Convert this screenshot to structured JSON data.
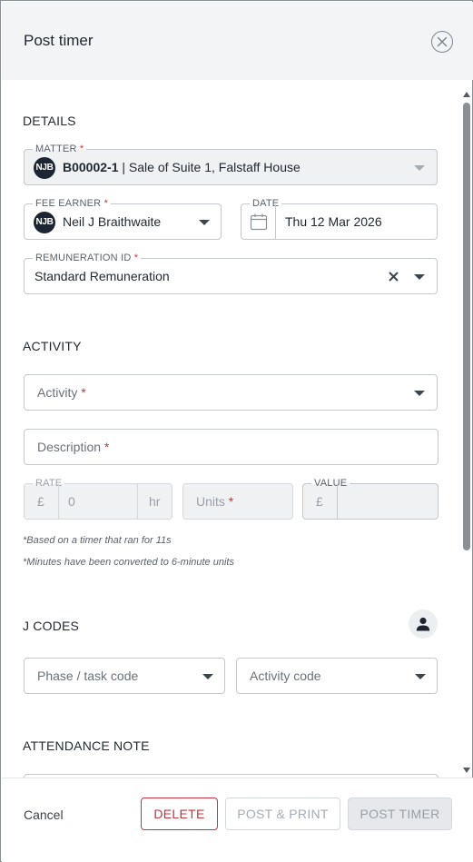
{
  "header": {
    "title": "Post timer",
    "close_icon": "close-circle-icon"
  },
  "details": {
    "section_title": "DETAILS",
    "matter": {
      "label": "MATTER",
      "required_mark": "*",
      "avatar": "NJB",
      "code": "B00002-1",
      "separator": " | ",
      "description": "Sale of Suite 1, Falstaff House"
    },
    "fee_earner": {
      "label": "FEE EARNER",
      "required_mark": "*",
      "avatar": "NJB",
      "value": "Neil J Braithwaite"
    },
    "date": {
      "label": "DATE",
      "value": "Thu 12 Mar 2026",
      "icon": "calendar-icon"
    },
    "remuneration": {
      "label": "REMUNERATION ID",
      "required_mark": "*",
      "value": "Standard Remuneration",
      "clear_icon": "clear-x-icon"
    }
  },
  "activity": {
    "section_title": "ACTIVITY",
    "activity_placeholder": "Activity",
    "description_placeholder": "Description",
    "required_mark": "*",
    "rate": {
      "label": "RATE",
      "currency": "£",
      "value": "0",
      "unit": "hr"
    },
    "units": {
      "placeholder": "Units"
    },
    "value_field": {
      "label": "VALUE",
      "currency": "£",
      "value": ""
    },
    "note_timer": "*Based on a timer that ran for 11s",
    "note_minutes": "*Minutes have been converted to 6-minute units"
  },
  "jcodes": {
    "section_title": "J CODES",
    "person_icon": "person-icon",
    "phase_placeholder": "Phase / task code",
    "activity_code_placeholder": "Activity code"
  },
  "attendance": {
    "section_title": "ATTENDANCE NOTE"
  },
  "footer": {
    "cancel_label": "Cancel",
    "delete_label": "DELETE",
    "post_print_label": "POST & PRINT",
    "post_timer_label": "POST TIMER"
  },
  "colors": {
    "header_bg": "#f2f4f6",
    "delete_red": "#c8323f",
    "avatar_bg": "#1b2533",
    "required_red": "#d0342c"
  }
}
